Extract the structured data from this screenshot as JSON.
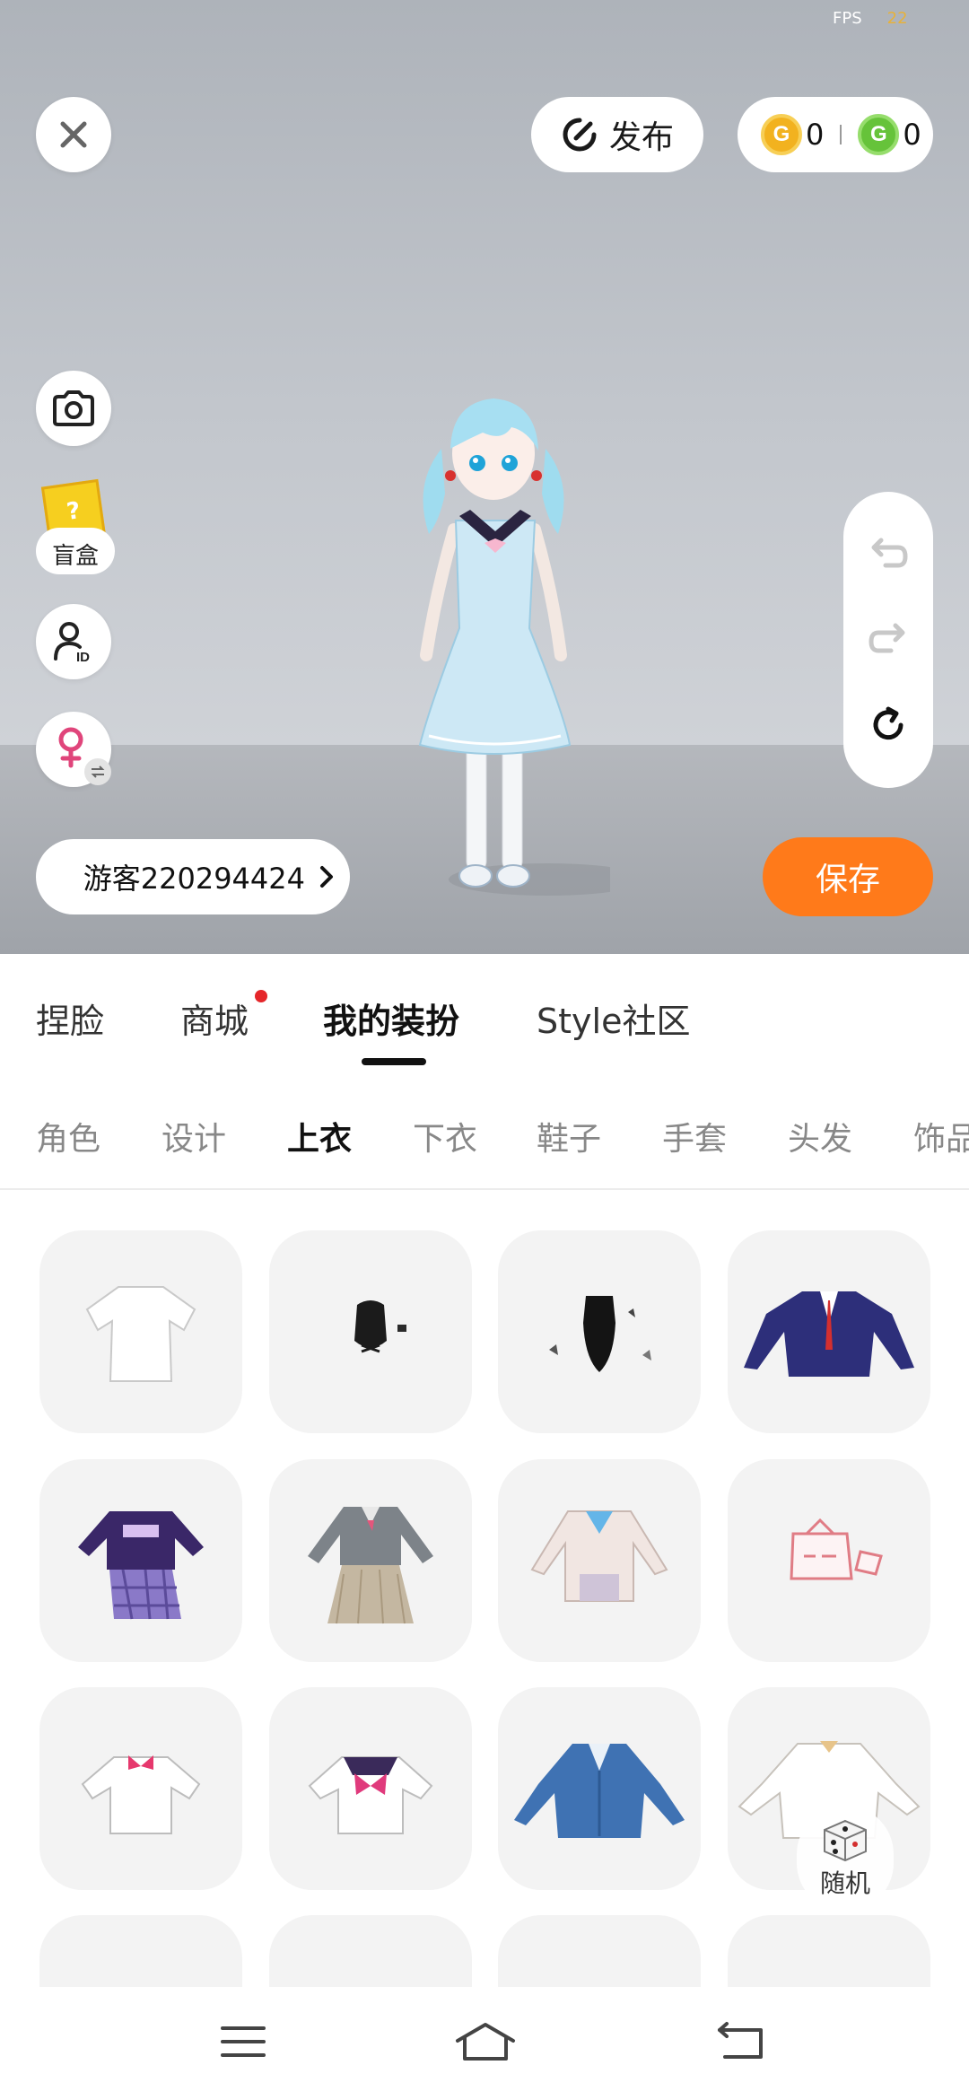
{
  "status": {
    "fps_label": "FPS",
    "fps_value": "22"
  },
  "toolbar": {
    "publish_label": "发布",
    "coins_gold": "0",
    "coins_green": "0",
    "coin_symbol": "G"
  },
  "left_tools": {
    "blindbox_label": "盲盒",
    "blindbox_mark": "?"
  },
  "user": {
    "name": "游客220294424"
  },
  "actions": {
    "save_label": "保存"
  },
  "main_tabs": [
    {
      "label": "捏脸"
    },
    {
      "label": "商城"
    },
    {
      "label": "我的装扮"
    },
    {
      "label": "Style社区"
    }
  ],
  "sub_tabs": [
    {
      "label": "角色"
    },
    {
      "label": "设计"
    },
    {
      "label": "上衣"
    },
    {
      "label": "下衣"
    },
    {
      "label": "鞋子"
    },
    {
      "label": "手套"
    },
    {
      "label": "头发"
    },
    {
      "label": "饰品"
    }
  ],
  "random": {
    "label": "随机"
  },
  "colors": {
    "accent": "#ff7a1a",
    "notification": "#e5262a",
    "coin_gold": "#f2b21f",
    "coin_green": "#66c33a"
  }
}
